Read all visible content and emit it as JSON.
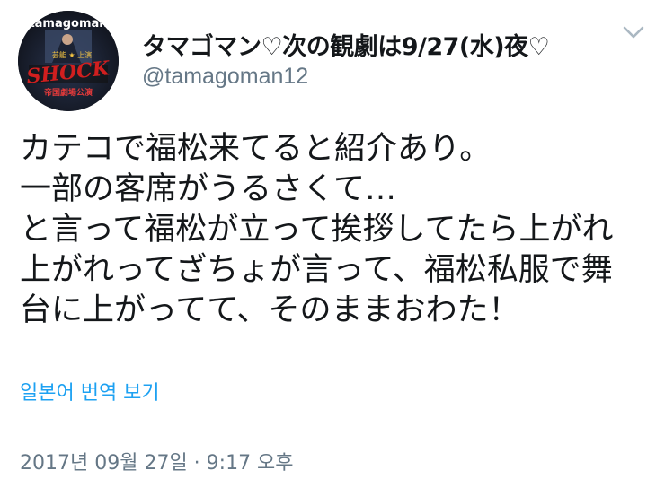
{
  "user": {
    "display_name": "タマゴマン♡次の観劇は9/27(水)夜♡",
    "handle": "@tamagoman12",
    "avatar": {
      "logo_text": "tamagoman",
      "logo_sub": "芸能 ★ 上演",
      "title_text": "SHOCK",
      "caption_text": "帝国劇場公演"
    }
  },
  "tweet": {
    "lines": [
      "カテコで福松来てると紹介あり。",
      "一部の客席がうるさくて…",
      "と言って福松が立って挨拶してたら上がれ",
      "上がれってざちょが言って、福松私服で舞",
      "台に上がってて、そのままおわた！"
    ],
    "translate_label": "일본어 번역 보기",
    "timestamp": "2017년 09월 27일 · 9:17 오후"
  },
  "icons": {
    "more": "chevron-down-icon"
  },
  "colors": {
    "text": "#14171a",
    "secondary": "#657786",
    "link": "#1da1f2",
    "chevron": "#aab8c2"
  }
}
